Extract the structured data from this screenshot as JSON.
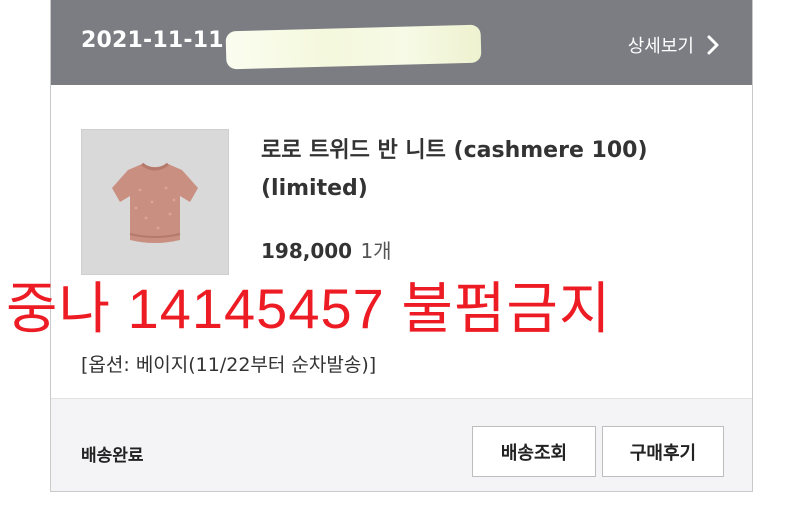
{
  "order": {
    "date": "2021-11-11",
    "detail_link_label": "상세보기",
    "icons": {
      "detail_chevron": "chevron-right-icon"
    }
  },
  "product": {
    "name": "로로 트위드 반 니트 (cashmere 100) (limited)",
    "price": "198,000",
    "quantity": "1개",
    "option": "[옵션: 베이지(11/22부터 순차발송)]",
    "thumbnail_color": "#c98f80"
  },
  "overlay": {
    "text": "중나 14145457 불펌금지",
    "color": "#ed1c24"
  },
  "footer": {
    "status": "배송완료",
    "track_button": "배송조회",
    "review_button": "구매후기"
  },
  "colors": {
    "header_bg": "#7b7d83",
    "footer_bg": "#f4f4f6"
  }
}
